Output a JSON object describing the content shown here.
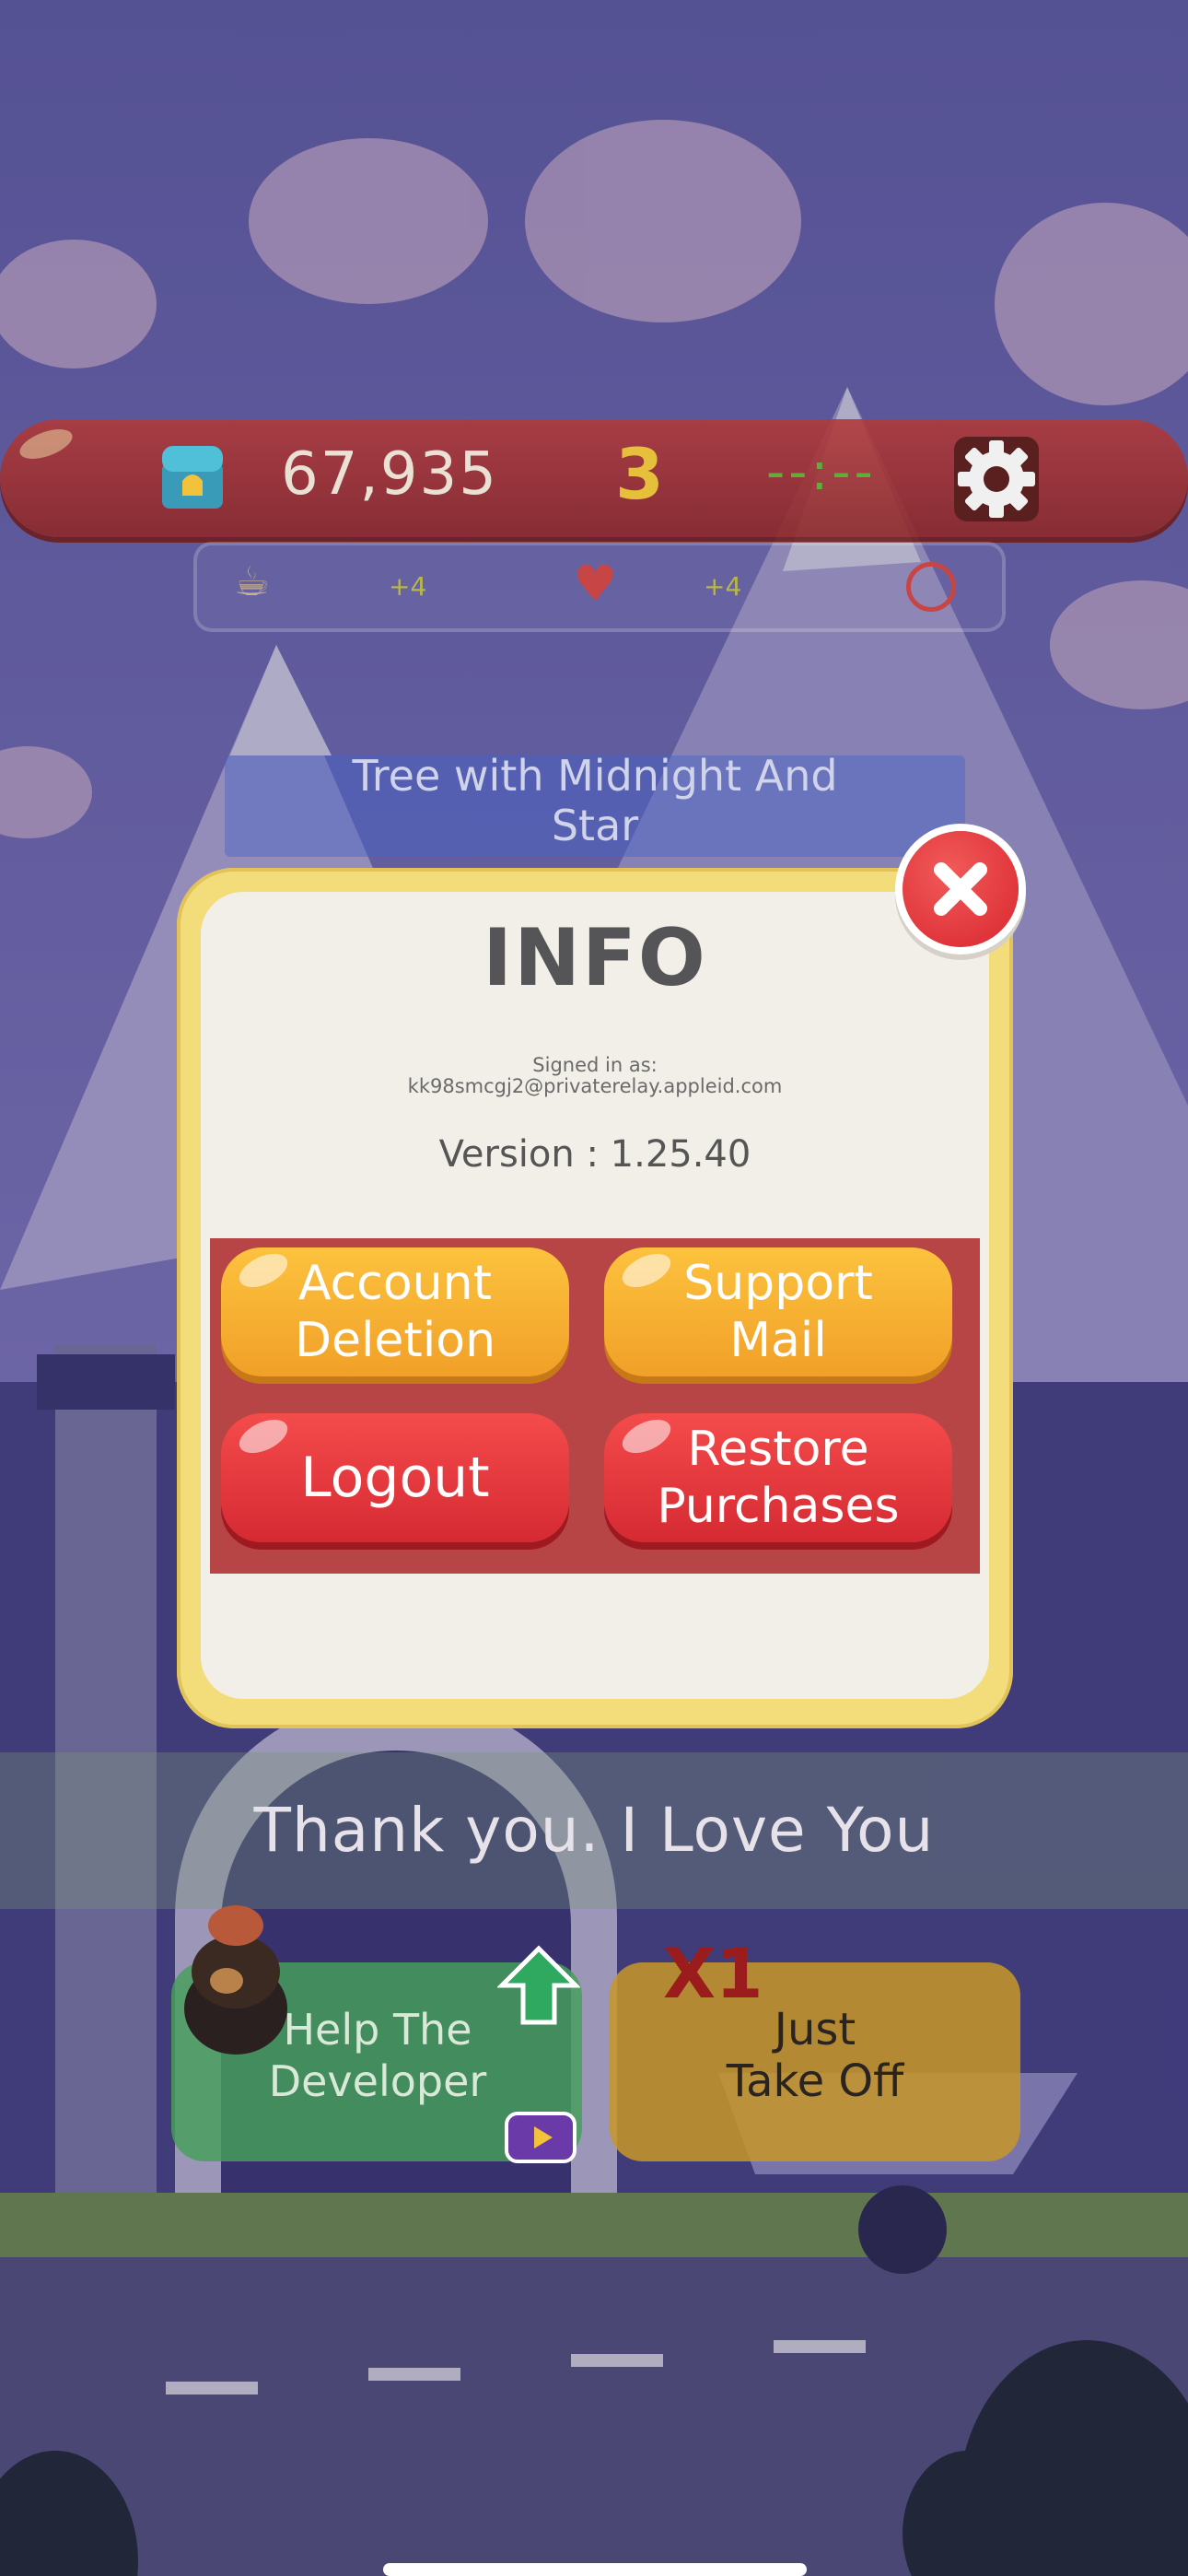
{
  "hud": {
    "coins": "67,935",
    "level": "3",
    "timer": "--:--",
    "stats": [
      "+4",
      "+4"
    ]
  },
  "level_name": "Tree with Midnight And\nStar",
  "dialog": {
    "title": "INFO",
    "signed_in_label": "Signed in as:",
    "signed_in_email": "kk98smcgj2@privaterelay.appleid.com",
    "version": "Version : 1.25.40",
    "buttons": {
      "account_deletion": "Account\nDeletion",
      "support_mail": "Support\nMail",
      "logout": "Logout",
      "restore_purchases": "Restore\nPurchases"
    }
  },
  "footer": {
    "thanks": "Thank you. I Love You",
    "help_developer": "Help The\nDeveloper",
    "take_off": "Just\nTake Off",
    "multiplier": "X1"
  },
  "colors": {
    "orange_button": "#f5ac2e",
    "red_button": "#e03a3f",
    "panel": "#b74545",
    "dialog_frame": "#f3dc7a"
  }
}
